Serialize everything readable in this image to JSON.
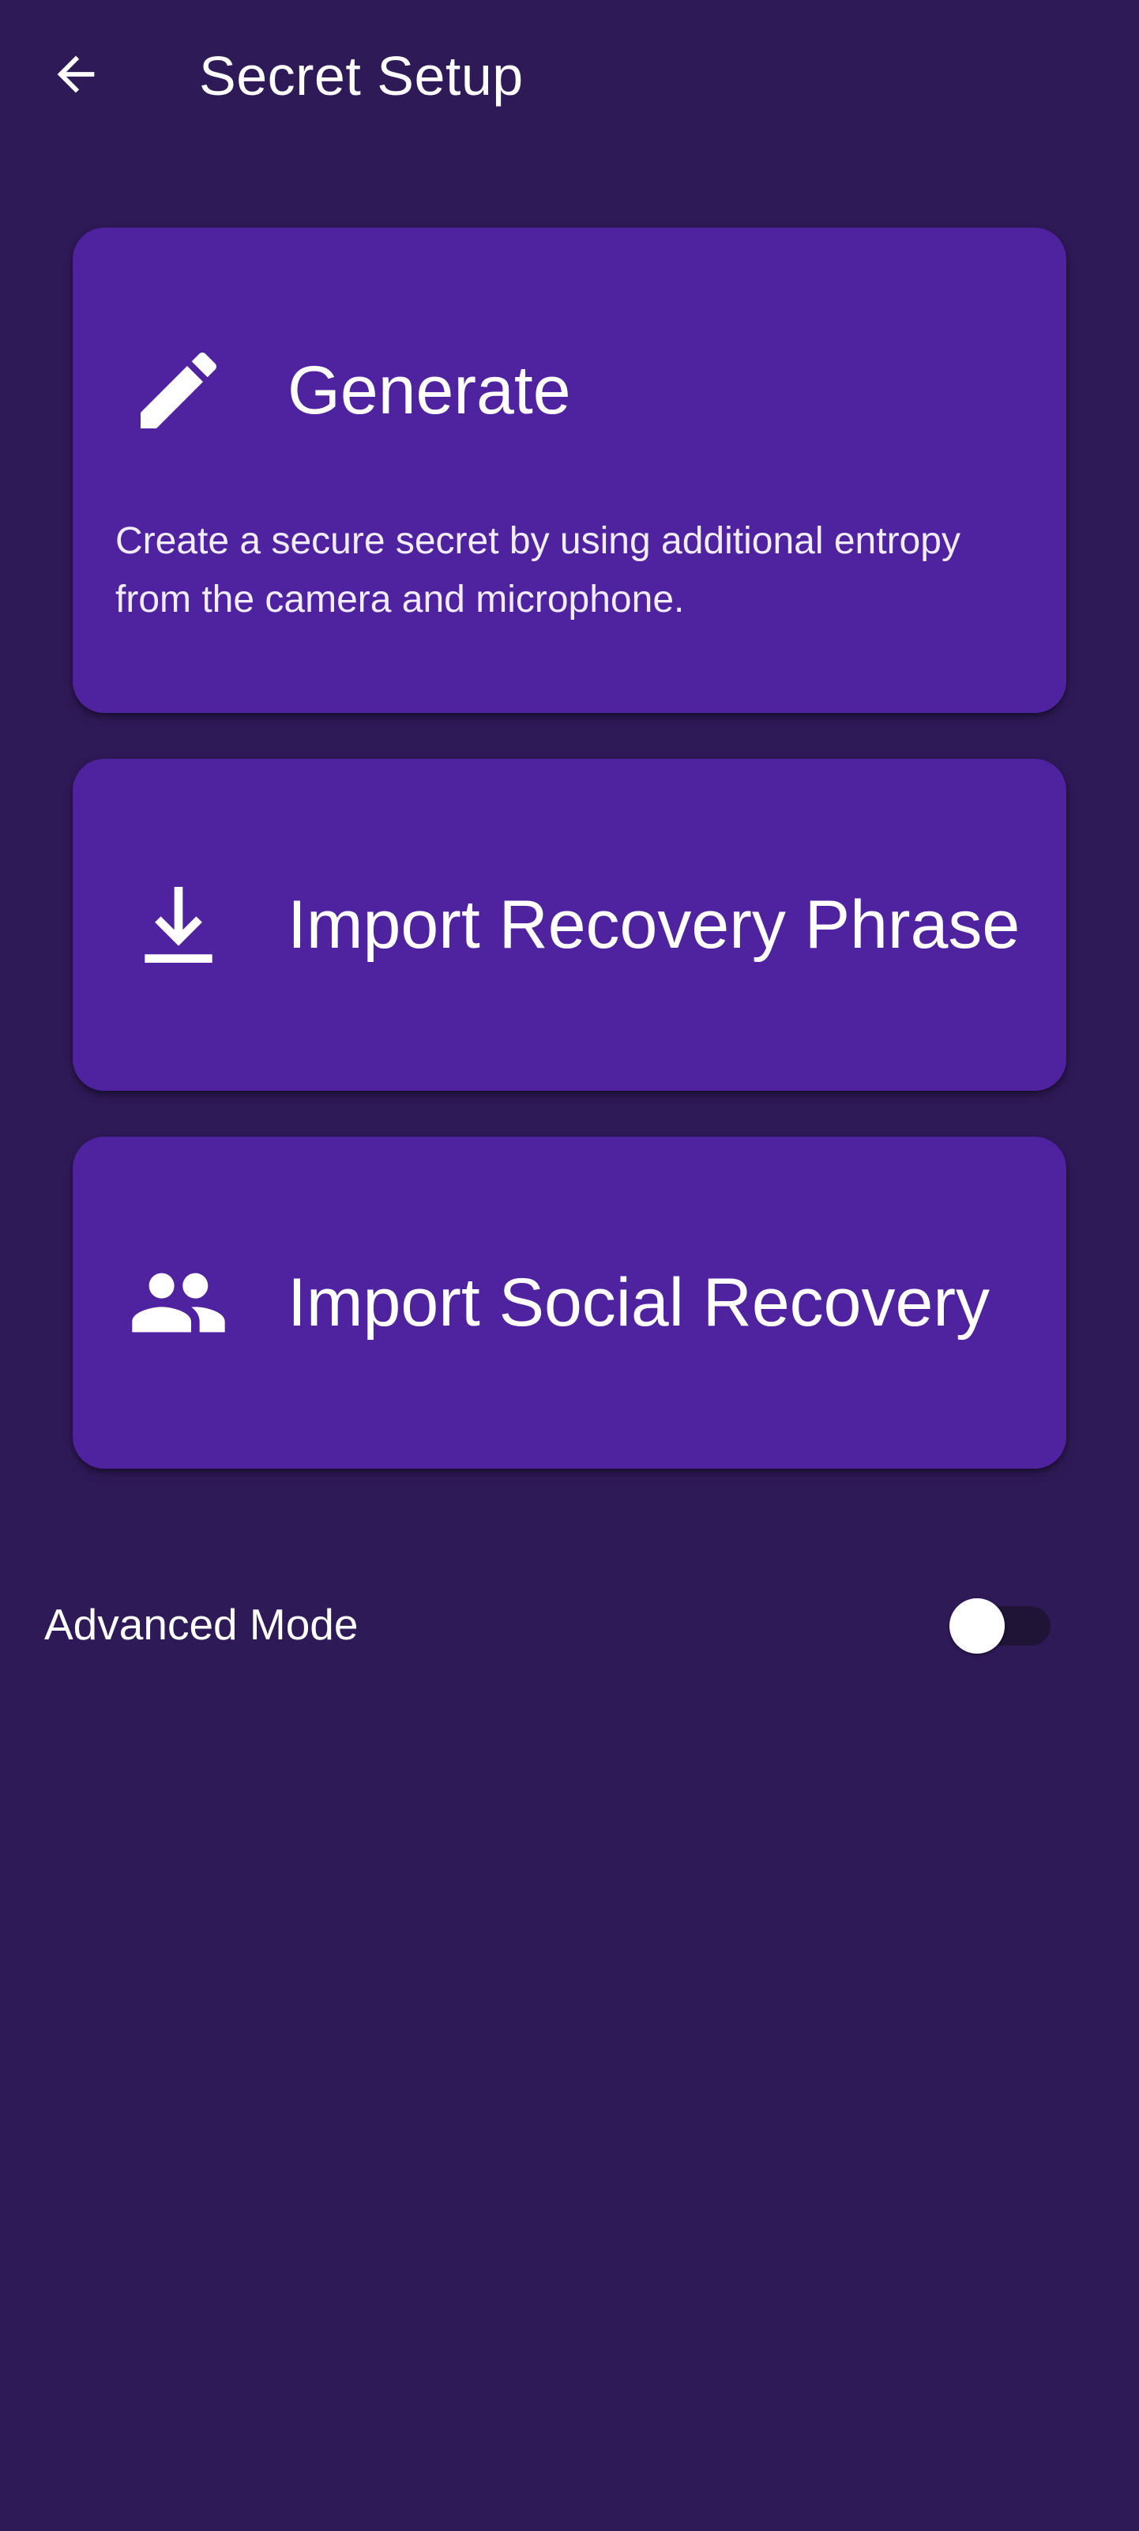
{
  "app_bar": {
    "title": "Secret Setup",
    "back_icon": "arrow-back-icon"
  },
  "options": {
    "generate": {
      "title": "Generate",
      "description": "Create a secure secret by using additional entropy from the camera and microphone.",
      "icon": "pencil-icon"
    },
    "import_phrase": {
      "title": "Import Recovery Phrase",
      "icon": "download-icon"
    },
    "import_social": {
      "title": "Import Social Recovery",
      "icon": "people-icon"
    }
  },
  "advanced_mode": {
    "label": "Advanced Mode",
    "enabled": false
  },
  "colors": {
    "background": "#2f1a58",
    "card": "#4f23a0",
    "text": "#ffffff"
  }
}
